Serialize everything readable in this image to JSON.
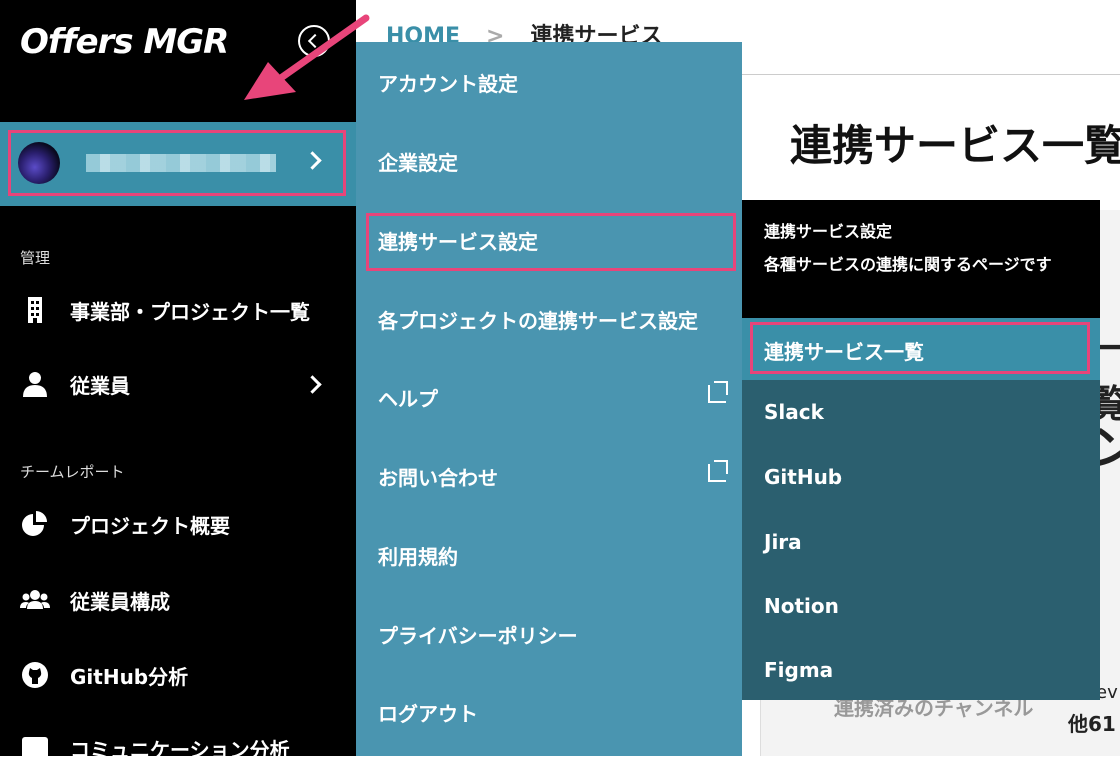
{
  "app": {
    "logo": "Offers MGR"
  },
  "sidebar": {
    "section_manage": "管理",
    "manage_items": [
      {
        "label": "事業部・プロジェクト一覧"
      },
      {
        "label": "従業員"
      }
    ],
    "section_report": "チームレポート",
    "report_items": [
      {
        "label": "プロジェクト概要"
      },
      {
        "label": "従業員構成"
      },
      {
        "label": "GitHub分析"
      },
      {
        "label": "コミュニケーション分析"
      }
    ]
  },
  "breadcrumb": {
    "home": "HOME",
    "current": "連携サービス"
  },
  "main": {
    "title": "連携サービス一覧",
    "peek_1": "一覧",
    "peek_2": "ン",
    "peek_3": "連携済みのチャンネル",
    "peek_4": "ev",
    "peek_5": "他61"
  },
  "menu": {
    "items": [
      {
        "label": "アカウント設定"
      },
      {
        "label": "企業設定"
      },
      {
        "label": "連携サービス設定"
      },
      {
        "label": "各プロジェクトの連携サービス設定"
      },
      {
        "label": "ヘルプ"
      },
      {
        "label": "お問い合わせ"
      },
      {
        "label": "利用規約"
      },
      {
        "label": "プライバシーポリシー"
      },
      {
        "label": "ログアウト"
      }
    ]
  },
  "submenu": {
    "title": "連携サービス設定",
    "description": "各種サービスの連携に関するページです",
    "items": [
      {
        "label": "連携サービス一覧"
      },
      {
        "label": "Slack"
      },
      {
        "label": "GitHub"
      },
      {
        "label": "Jira"
      },
      {
        "label": "Notion"
      },
      {
        "label": "Figma"
      }
    ]
  },
  "colors": {
    "sidebar_bg": "#000000",
    "menu_bg": "#4a95b0",
    "submenu_bg": "#2b5f6f",
    "accent": "#3a8fa8",
    "highlight": "#e8457a"
  }
}
